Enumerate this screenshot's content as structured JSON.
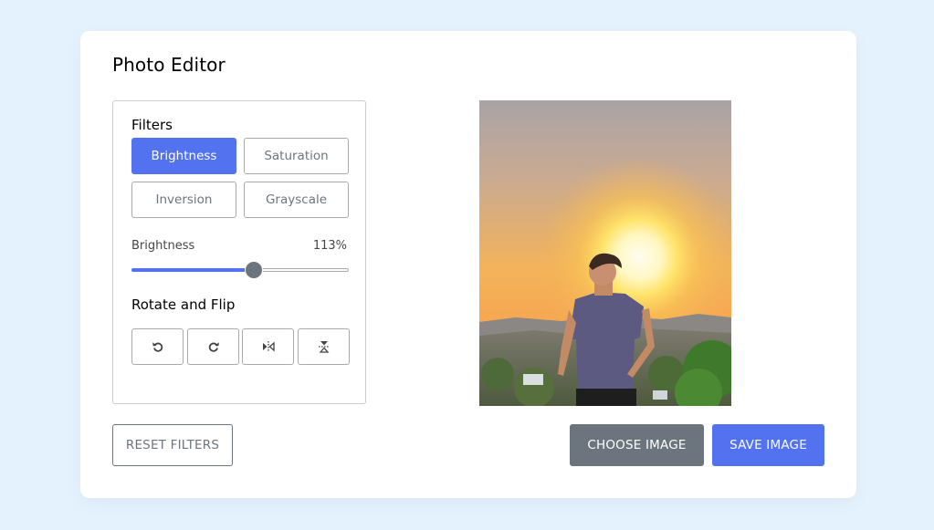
{
  "app": {
    "title": "Photo Editor"
  },
  "filters": {
    "heading": "Filters",
    "options": [
      {
        "label": "Brightness",
        "active": true
      },
      {
        "label": "Saturation",
        "active": false
      },
      {
        "label": "Inversion",
        "active": false
      },
      {
        "label": "Grayscale",
        "active": false
      }
    ]
  },
  "slider": {
    "name": "Brightness",
    "value_text": "113%",
    "value": 113,
    "min": 0,
    "max": 200
  },
  "rotate": {
    "heading": "Rotate and Flip",
    "buttons": [
      {
        "icon": "rotate-left-icon"
      },
      {
        "icon": "rotate-right-icon"
      },
      {
        "icon": "flip-horizontal-icon"
      },
      {
        "icon": "flip-vertical-icon"
      }
    ]
  },
  "actions": {
    "reset": "RESET FILTERS",
    "choose": "CHOOSE IMAGE",
    "save": "SAVE IMAGE"
  },
  "colors": {
    "accent": "#5372f0",
    "secondary": "#6c757d",
    "page_background": "#e3f2fd"
  }
}
